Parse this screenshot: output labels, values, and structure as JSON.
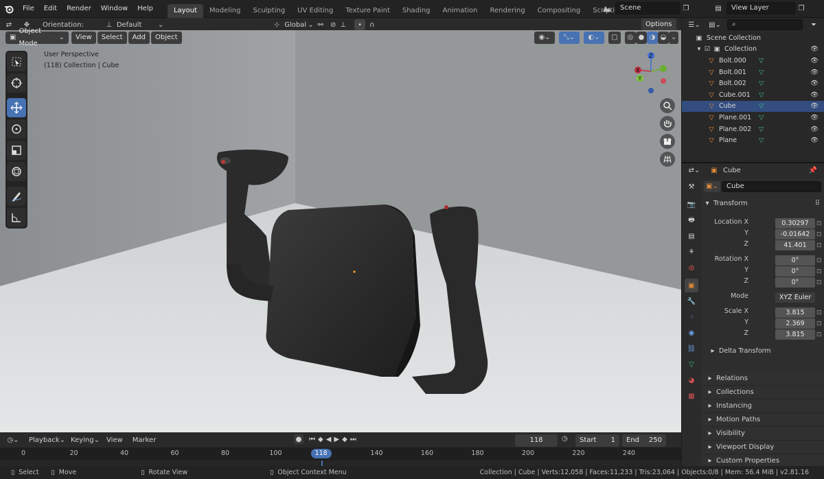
{
  "menu": [
    "File",
    "Edit",
    "Render",
    "Window",
    "Help"
  ],
  "workspaces": [
    {
      "label": "Layout",
      "active": true
    },
    {
      "label": "Modeling"
    },
    {
      "label": "Sculpting"
    },
    {
      "label": "UV Editing"
    },
    {
      "label": "Texture Paint"
    },
    {
      "label": "Shading"
    },
    {
      "label": "Animation"
    },
    {
      "label": "Rendering"
    },
    {
      "label": "Compositing"
    },
    {
      "label": "Scripting"
    }
  ],
  "add_workspace": "+",
  "scene": "Scene",
  "view_layer": "View Layer",
  "toolheader": {
    "orientation_label": "Orientation:",
    "orientation_value": "Default",
    "transform_space": "Global",
    "options": "Options"
  },
  "viewport_header": {
    "mode": "Object Mode",
    "view": "View",
    "select": "Select",
    "add": "Add",
    "object": "Object"
  },
  "overlay": {
    "line1": "User Perspective",
    "line2": "(118) Collection | Cube"
  },
  "gizmo": {
    "z": "Z",
    "y": "Y",
    "x": "X"
  },
  "outliner": {
    "root": "Scene Collection",
    "collection": "Collection",
    "items": [
      "Bolt.000",
      "Bolt.001",
      "Bolt.002",
      "Cube.001",
      "Cube",
      "Plane.001",
      "Plane.002",
      "Plane"
    ],
    "selected": "Cube"
  },
  "properties": {
    "object_name": "Cube",
    "datablock": "Cube",
    "transform_title": "Transform",
    "location": {
      "label": "Location X",
      "x": "0.30297",
      "y": "-0.01642",
      "z": "41.401"
    },
    "rotation": {
      "label": "Rotation X",
      "x": "0°",
      "y": "0°",
      "z": "0°"
    },
    "mode_label": "Mode",
    "mode_value": "XYZ Euler",
    "scale": {
      "label": "Scale X",
      "x": "3.815",
      "y": "2.369",
      "z": "3.815"
    },
    "axis_y": "Y",
    "axis_z": "Z",
    "delta": "Delta Transform",
    "panels": [
      "Relations",
      "Collections",
      "Instancing",
      "Motion Paths",
      "Visibility",
      "Viewport Display",
      "Custom Properties"
    ]
  },
  "timeline": {
    "playback": "Playback",
    "keying": "Keying",
    "view": "View",
    "marker": "Marker",
    "current_frame": "118",
    "start_label": "Start",
    "start": "1",
    "end_label": "End",
    "end": "250",
    "ticks": [
      "0",
      "20",
      "40",
      "60",
      "80",
      "100",
      "118",
      "140",
      "160",
      "180",
      "200",
      "220",
      "240"
    ]
  },
  "status": {
    "select": "Select",
    "move": "Move",
    "rotate": "Rotate View",
    "context": "Object Context Menu",
    "info": "Collection | Cube | Verts:12,058 | Faces:11,233 | Tris:23,064 | Objects:0/8 | Mem: 56.4 MiB | v2.81.16"
  },
  "colors": {
    "accent": "#4772b3",
    "selected_row": "#334d80",
    "mesh_icon": "#e08a3a",
    "data_icon": "#3fbf7f"
  }
}
